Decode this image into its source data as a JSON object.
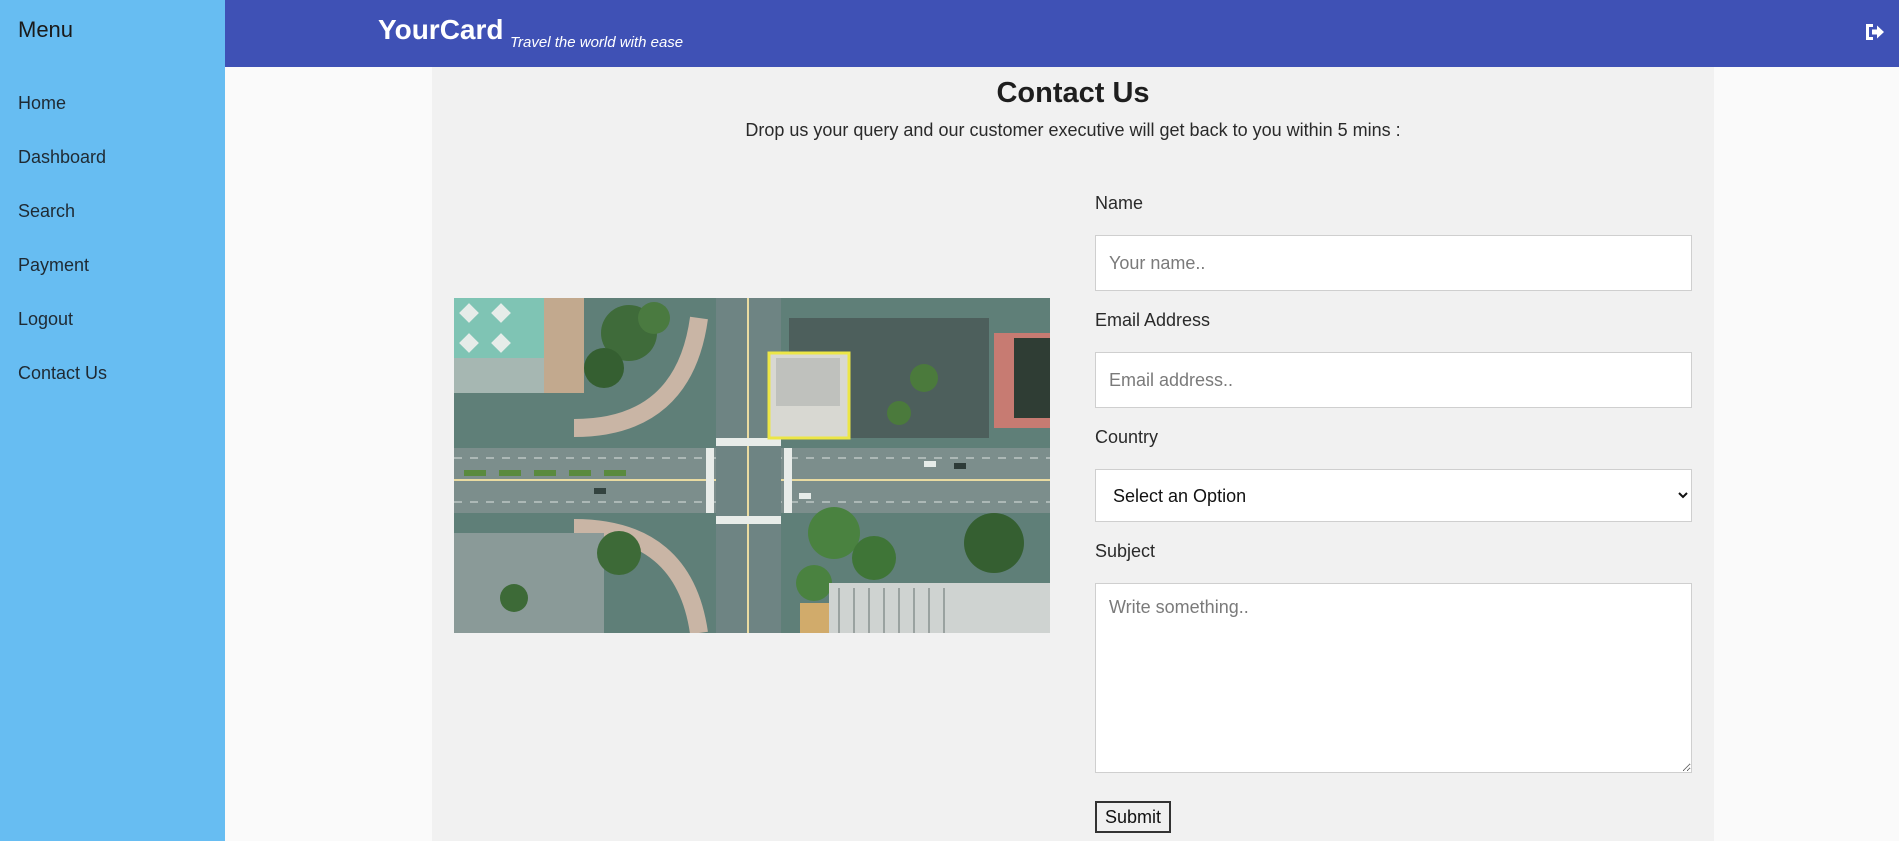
{
  "sidebar": {
    "title": "Menu",
    "items": [
      {
        "label": "Home"
      },
      {
        "label": "Dashboard"
      },
      {
        "label": "Search"
      },
      {
        "label": "Payment"
      },
      {
        "label": "Logout"
      },
      {
        "label": "Contact Us"
      }
    ]
  },
  "header": {
    "brand": "YourCard",
    "tagline": "Travel the world with ease",
    "logout_icon": "sign-out-icon"
  },
  "main": {
    "title": "Contact Us",
    "subtitle": "Drop us your query and our customer executive will get back to you within 5 mins :",
    "image_subject": "aerial-city-intersection",
    "form": {
      "name_label": "Name",
      "name_placeholder": "Your name..",
      "email_label": "Email Address",
      "email_placeholder": "Email address..",
      "country_label": "Country",
      "country_selected": "Select an Option",
      "subject_label": "Subject",
      "subject_placeholder": "Write something..",
      "submit_label": "Submit"
    }
  },
  "colors": {
    "sidebar": "#67bdf2",
    "header": "#3f51b5",
    "panel": "#f1f1f1"
  }
}
